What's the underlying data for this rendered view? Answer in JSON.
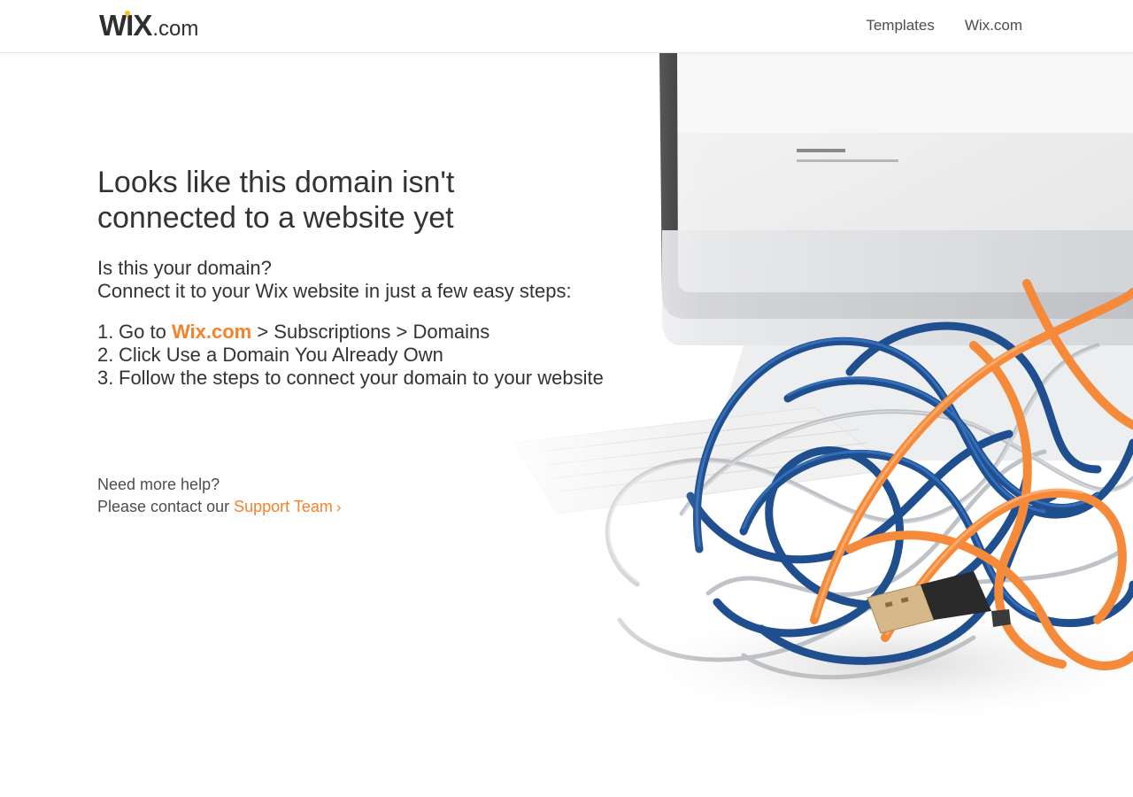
{
  "header": {
    "logo_wix": "WIX",
    "logo_com": ".com",
    "nav": {
      "templates": "Templates",
      "wixcom": "Wix.com"
    }
  },
  "main": {
    "headline_line1": "Looks like this domain isn't",
    "headline_line2": "connected to a website yet",
    "intro_line1": "Is this your domain?",
    "intro_line2": "Connect it to your Wix website in just a few easy steps:",
    "steps": [
      {
        "number": "1.",
        "prefix": "Go to",
        "link": "Wix.com",
        "suffix": "> Subscriptions > Domains"
      },
      {
        "number": "2.",
        "text": "Click Use a Domain You Already Own"
      },
      {
        "number": "3.",
        "text": "Follow the steps to connect your domain to your website"
      }
    ]
  },
  "help": {
    "line1": "Need more help?",
    "line2_prefix": "Please contact our",
    "support_link": "Support Team",
    "chevron": "›"
  },
  "colors": {
    "accent": "#f5822b",
    "text": "#333333",
    "logo_dot": "#fbbd21",
    "cable_blue": "#1f4f8f",
    "cable_orange": "#f58a3a"
  },
  "icons": {
    "chevron": "chevron-right-icon"
  }
}
